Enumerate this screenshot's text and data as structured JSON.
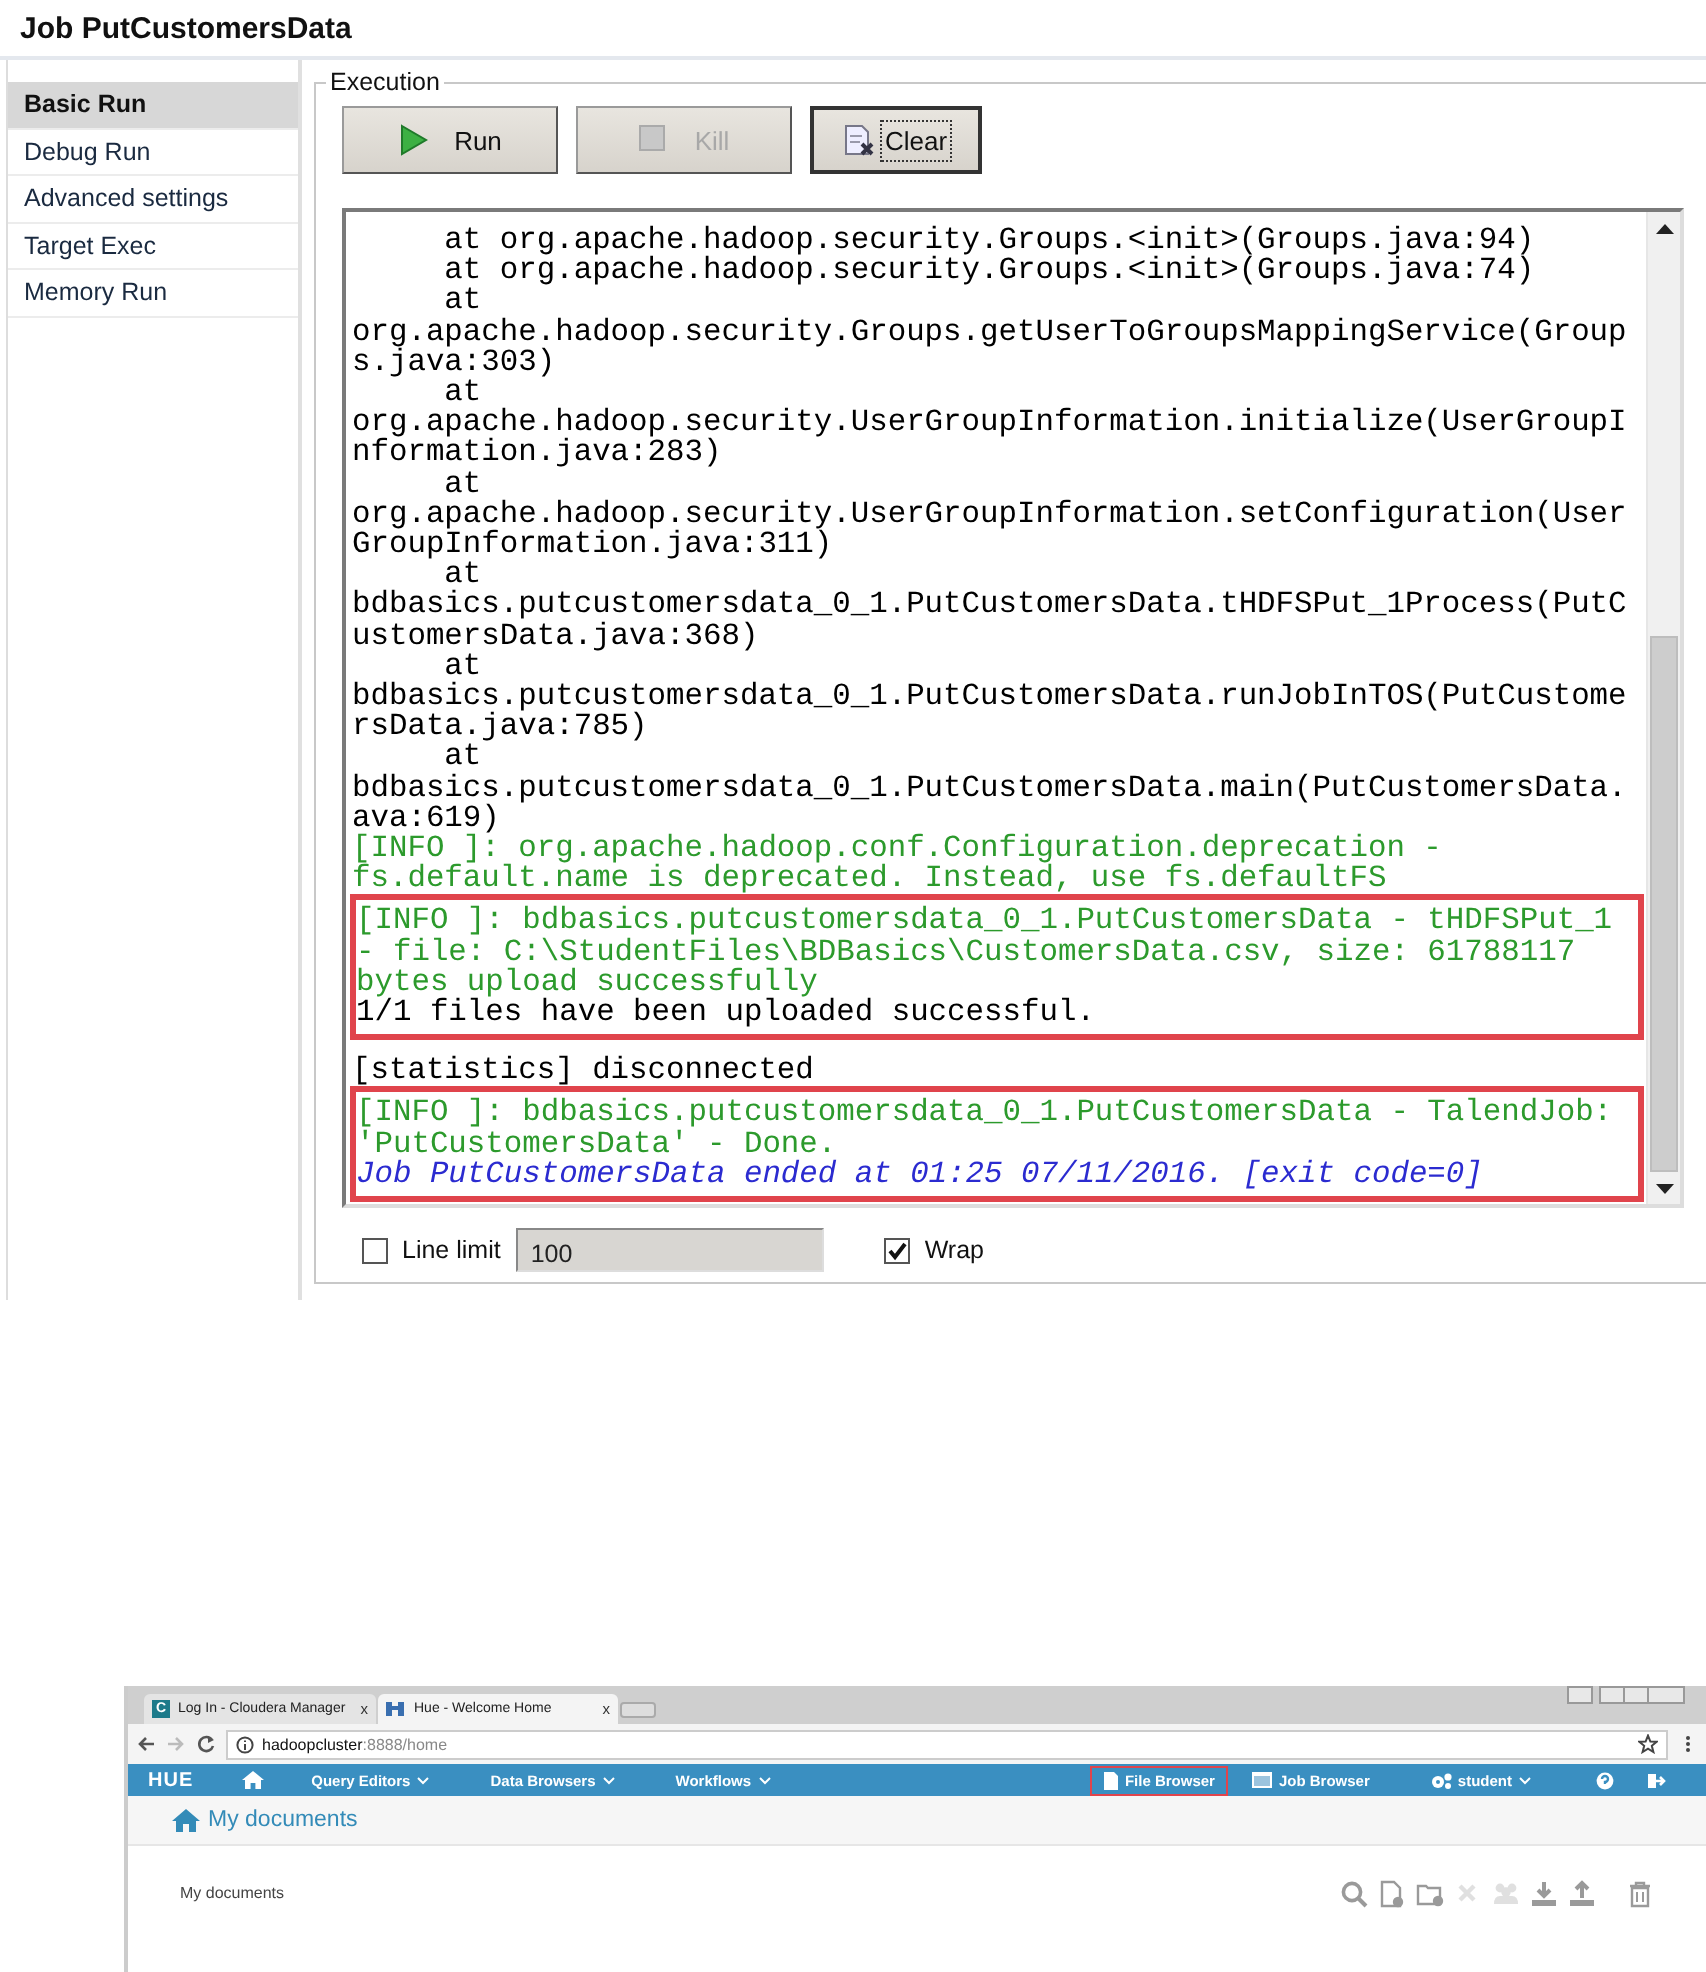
{
  "job_window": {
    "title": "Job PutCustomersData",
    "sidebar": [
      {
        "label": "Basic Run",
        "selected": true
      },
      {
        "label": "Debug Run",
        "selected": false
      },
      {
        "label": "Advanced settings",
        "selected": false
      },
      {
        "label": "Target Exec",
        "selected": false
      },
      {
        "label": "Memory Run",
        "selected": false
      }
    ],
    "execution": {
      "legend": "Execution",
      "buttons": [
        {
          "label": "Run",
          "kind": "run",
          "disabled": false,
          "focused": false
        },
        {
          "label": "Kill",
          "kind": "kill",
          "disabled": true,
          "focused": false
        },
        {
          "label": "Clear",
          "kind": "clear",
          "disabled": false,
          "focused": true
        }
      ],
      "console": {
        "blocks": [
          {
            "highlighted": false,
            "lines": [
              {
                "kind": "plain",
                "text": "     at org.apache.hadoop.security.Groups.<init>(Groups.java:94)"
              },
              {
                "kind": "plain",
                "text": "     at org.apache.hadoop.security.Groups.<init>(Groups.java:74)"
              },
              {
                "kind": "plain",
                "text": "     at"
              },
              {
                "kind": "plain",
                "text": "org.apache.hadoop.security.Groups.getUserToGroupsMappingService(Group"
              },
              {
                "kind": "plain",
                "text": "s.java:303)"
              },
              {
                "kind": "plain",
                "text": "     at"
              },
              {
                "kind": "plain",
                "text": "org.apache.hadoop.security.UserGroupInformation.initialize(UserGroupI"
              },
              {
                "kind": "plain",
                "text": "nformation.java:283)"
              },
              {
                "kind": "plain",
                "text": "     at"
              },
              {
                "kind": "plain",
                "text": "org.apache.hadoop.security.UserGroupInformation.setConfiguration(User"
              },
              {
                "kind": "plain",
                "text": "GroupInformation.java:311)"
              },
              {
                "kind": "plain",
                "text": "     at"
              },
              {
                "kind": "plain",
                "text": "bdbasics.putcustomersdata_0_1.PutCustomersData.tHDFSPut_1Process(PutC"
              },
              {
                "kind": "plain",
                "text": "ustomersData.java:368)"
              },
              {
                "kind": "plain",
                "text": "     at"
              },
              {
                "kind": "plain",
                "text": "bdbasics.putcustomersdata_0_1.PutCustomersData.runJobInTOS(PutCustome"
              },
              {
                "kind": "plain",
                "text": "rsData.java:785)"
              },
              {
                "kind": "plain",
                "text": "     at"
              },
              {
                "kind": "plain",
                "text": "bdbasics.putcustomersdata_0_1.PutCustomersData.main(PutCustomersData."
              },
              {
                "kind": "plain",
                "text": "ava:619)"
              },
              {
                "kind": "info",
                "text": "[INFO ]: org.apache.hadoop.conf.Configuration.deprecation -"
              },
              {
                "kind": "info",
                "text": "fs.default.name is deprecated. Instead, use fs.defaultFS"
              }
            ]
          },
          {
            "highlighted": true,
            "lines": [
              {
                "kind": "info",
                "text": "[INFO ]: bdbasics.putcustomersdata_0_1.PutCustomersData - tHDFSPut_1"
              },
              {
                "kind": "info",
                "text": "- file: C:\\StudentFiles\\BDBasics\\CustomersData.csv, size: 61788117"
              },
              {
                "kind": "info",
                "text": "bytes upload successfully"
              },
              {
                "kind": "plain",
                "text": "1/1 files have been uploaded successful."
              }
            ]
          },
          {
            "highlighted": false,
            "lines": [
              {
                "kind": "plain",
                "text": "[statistics] disconnected"
              }
            ]
          },
          {
            "highlighted": true,
            "lines": [
              {
                "kind": "info",
                "text": "[INFO ]: bdbasics.putcustomersdata_0_1.PutCustomersData - TalendJob:"
              },
              {
                "kind": "info",
                "text": "'PutCustomersData' - Done."
              },
              {
                "kind": "job",
                "text": "Job PutCustomersData ended at 01:25 07/11/2016. [exit code=0]"
              }
            ]
          }
        ]
      },
      "line_limit": {
        "label": "Line limit",
        "checked": false,
        "value": "100"
      },
      "wrap": {
        "label": "Wrap",
        "checked": true
      }
    }
  },
  "browser": {
    "tabs": [
      {
        "label": "Log In - Cloudera Manager",
        "badge": "C",
        "selected": false,
        "close": "x"
      },
      {
        "label": "Hue - Welcome Home",
        "selected": true,
        "close": "x"
      }
    ],
    "address": {
      "host": "hadoopcluster",
      "path": ":8888/home"
    },
    "nav": [
      {
        "kind": "logo",
        "label": "HUE"
      },
      {
        "kind": "home"
      },
      {
        "kind": "menu",
        "label": "Query Editors"
      },
      {
        "kind": "menu",
        "label": "Data Browsers"
      },
      {
        "kind": "menu",
        "label": "Workflows"
      },
      {
        "kind": "spacer"
      },
      {
        "kind": "file",
        "label": "File Browser",
        "highlighted": true
      },
      {
        "kind": "job",
        "label": "Job Browser",
        "highlighted": false
      },
      {
        "kind": "user",
        "label": "student"
      },
      {
        "kind": "help"
      },
      {
        "kind": "logout"
      }
    ],
    "header": "My documents",
    "section_label": "My documents",
    "toolbar": [
      {
        "kind": "search",
        "disabled": false
      },
      {
        "kind": "new-document",
        "disabled": false
      },
      {
        "kind": "new-folder",
        "disabled": false
      },
      {
        "kind": "delete",
        "disabled": true
      },
      {
        "kind": "users",
        "disabled": true
      },
      {
        "kind": "download",
        "disabled": false
      },
      {
        "kind": "upload",
        "disabled": false
      },
      {
        "kind": "trash",
        "disabled": false
      }
    ]
  }
}
